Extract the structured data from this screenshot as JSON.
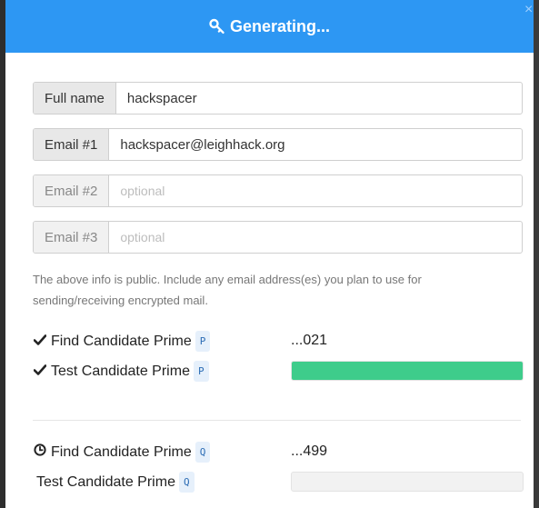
{
  "dialog": {
    "title": "Generating...",
    "title_icon": "key-icon",
    "close_label": "×"
  },
  "form": {
    "fields": [
      {
        "label": "Full name",
        "value": "hackspacer",
        "placeholder": ""
      },
      {
        "label": "Email #1",
        "value": "hackspacer@leighhack.org",
        "placeholder": ""
      },
      {
        "label": "Email #2",
        "value": "",
        "placeholder": "optional"
      },
      {
        "label": "Email #3",
        "value": "",
        "placeholder": "optional"
      }
    ],
    "info": "The above info is public. Include any email address(es) you plan to use for sending/receiving encrypted mail."
  },
  "steps": {
    "p_find": {
      "label": "Find Candidate Prime",
      "badge": "P",
      "status_icon": "check-icon",
      "result": "...021"
    },
    "p_test": {
      "label": "Test Candidate Prime",
      "badge": "P",
      "status_icon": "check-icon",
      "progress": 1.0
    },
    "q_find": {
      "label": "Find Candidate Prime",
      "badge": "Q",
      "status_icon": "clock-icon",
      "result": "...499"
    },
    "q_test": {
      "label": "Test Candidate Prime",
      "badge": "Q",
      "status_icon": "",
      "progress": 0.0
    }
  },
  "colors": {
    "header": "#2d97f3",
    "progress_fill": "#3ecc8b",
    "badge_bg": "#e6f0fb"
  }
}
